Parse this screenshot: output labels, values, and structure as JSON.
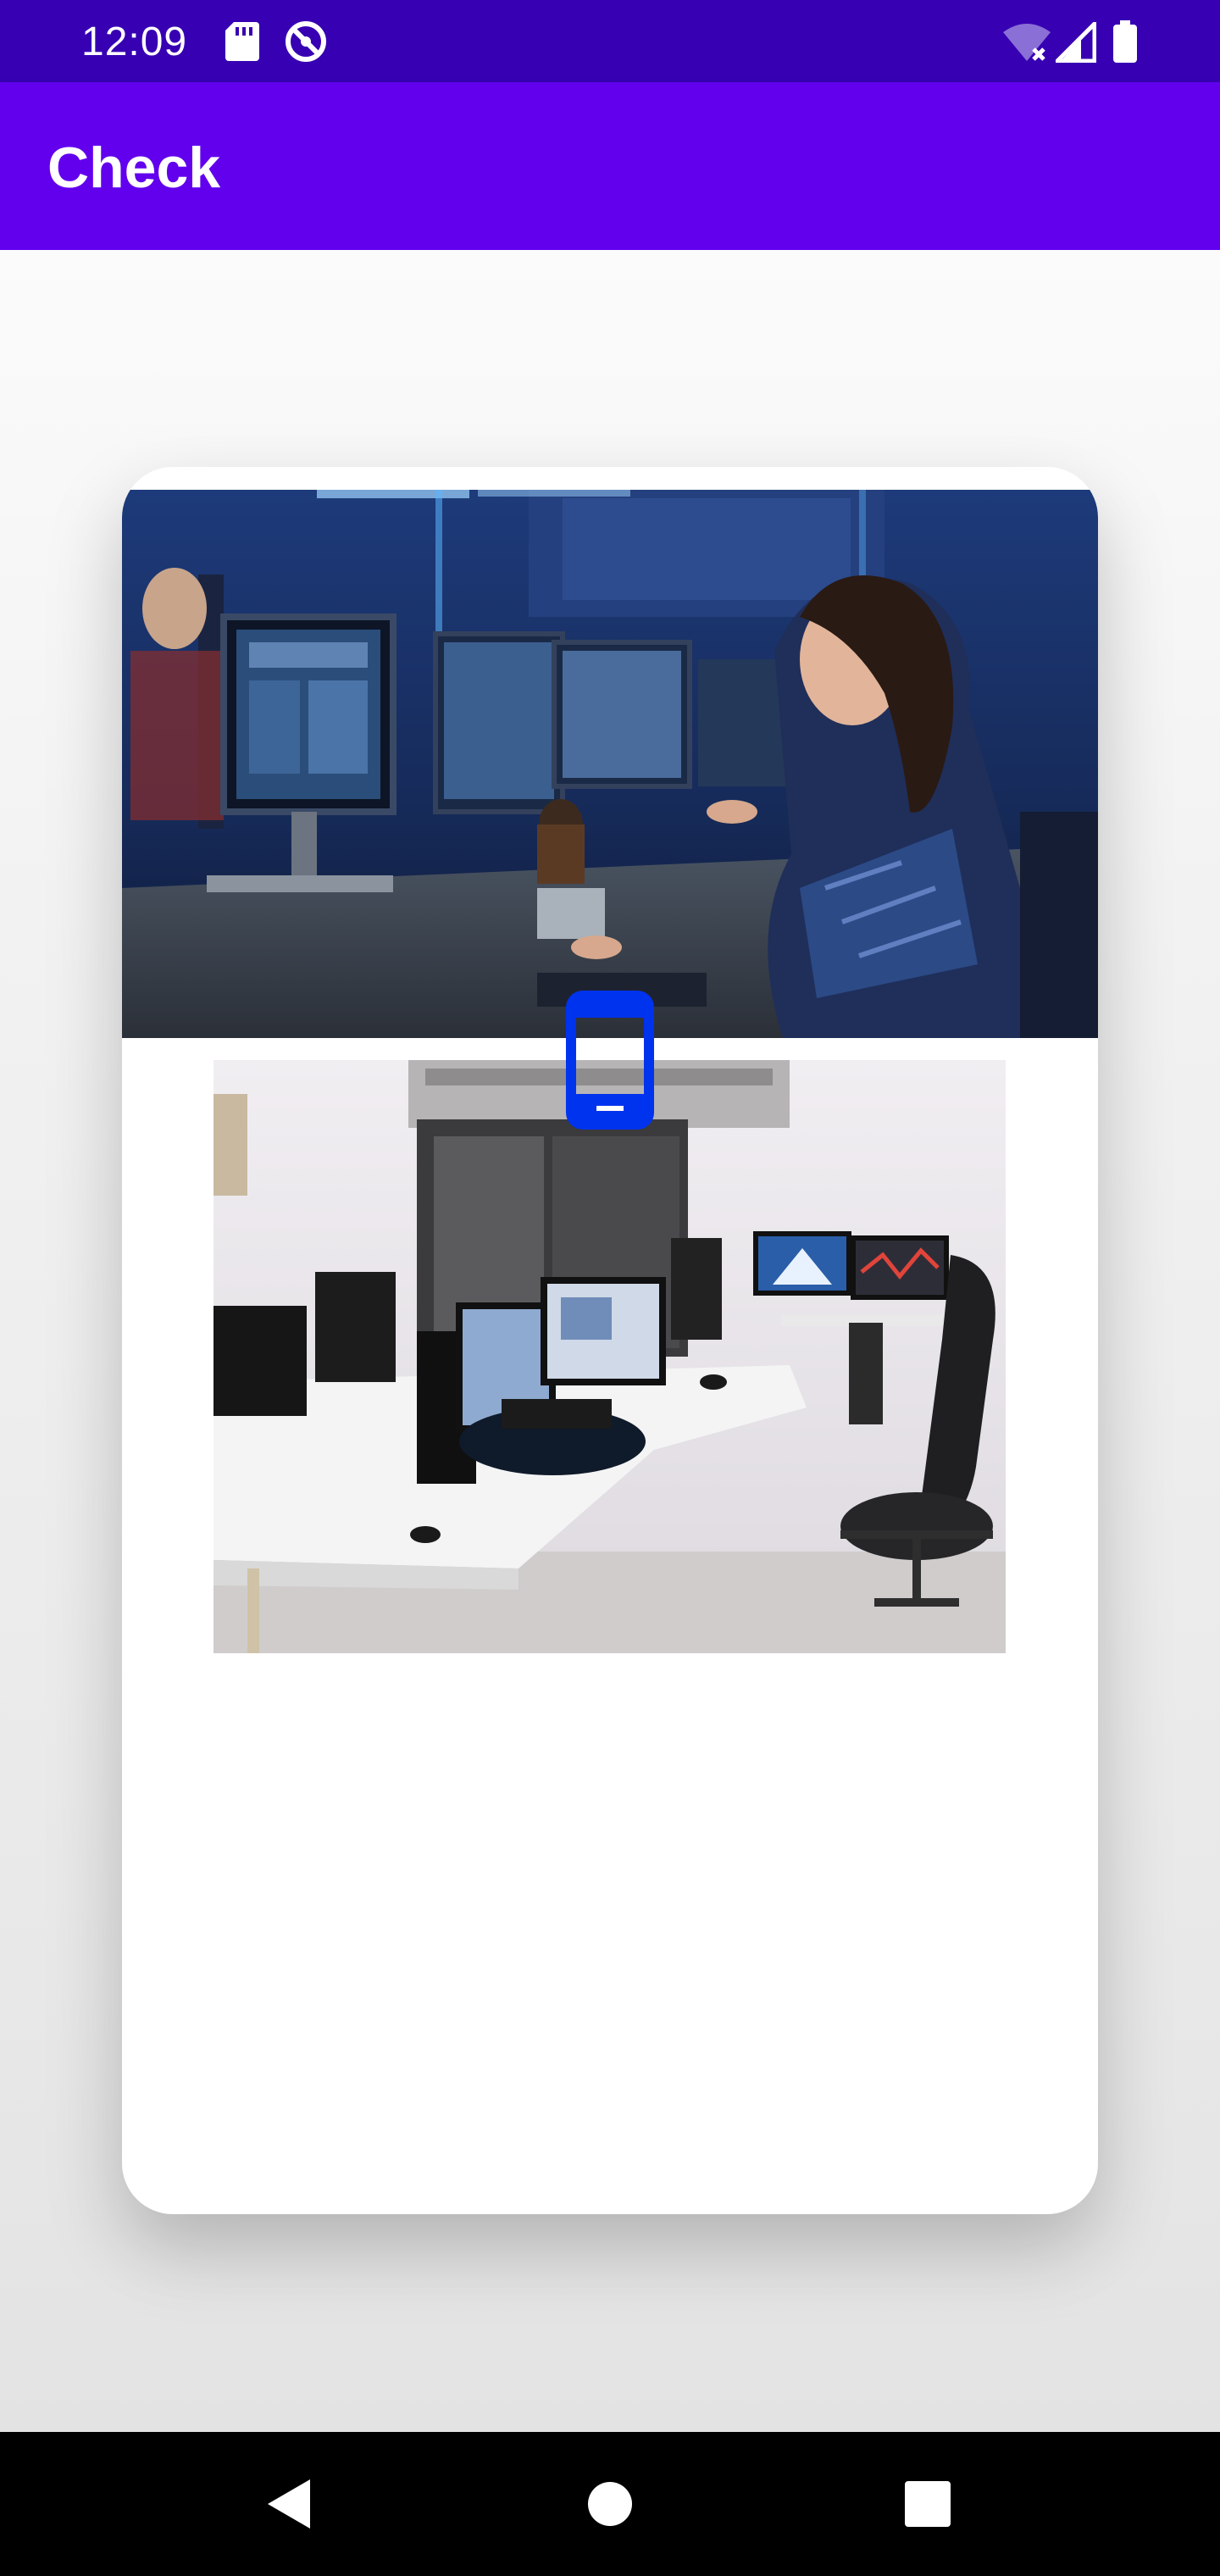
{
  "status_bar": {
    "time": "12:09",
    "left_icons": [
      "sd-card-icon",
      "do-not-disturb-icon"
    ],
    "right_icons": [
      "wifi-off-icon",
      "cell-signal-icon",
      "battery-icon"
    ],
    "background": "#3700b3"
  },
  "app_bar": {
    "title": "Check",
    "background": "#6200ee"
  },
  "card": {
    "images": [
      {
        "name": "developers-working-photo",
        "description_icon": "photo-icon"
      },
      {
        "name": "office-workstation-photo",
        "description_icon": "photo-icon"
      }
    ],
    "overlay_icon": "smartphone-icon",
    "overlay_icon_color": "#0033ee"
  },
  "nav_bar": {
    "buttons": [
      "back-icon",
      "home-icon",
      "recents-icon"
    ]
  }
}
